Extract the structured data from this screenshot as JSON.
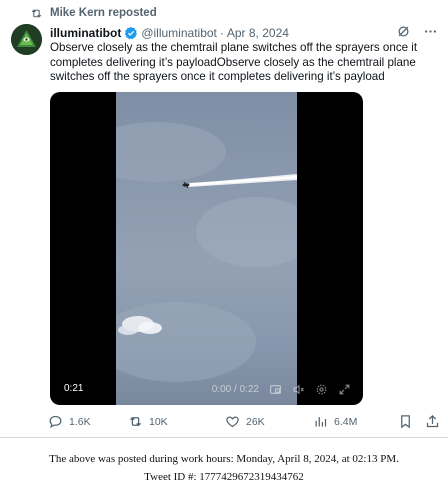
{
  "repost": {
    "label": "Mike Kern reposted"
  },
  "author": {
    "display_name": "illuminatibot",
    "handle": "@illuminatibot",
    "separator": "·",
    "date": "Apr 8, 2024"
  },
  "tweet": {
    "text": "Observe closely as the chemtrail plane switches off the sprayers once it completes delivering it’s payloadObserve closely as the chemtrail plane switches off the sprayers once it completes delivering it’s payload"
  },
  "video": {
    "elapsed": "0:21",
    "position": "0:00 / 0:22"
  },
  "actions": {
    "replies": "1.6K",
    "reposts": "10K",
    "likes": "26K",
    "views": "6.4M"
  },
  "footer": {
    "line1": "The above was posted during work hours: Monday, April 8, 2024, at 02:13 PM.",
    "line2": "Tweet ID #: 1777429672319434762"
  },
  "colors": {
    "verified": "#1d9bf0",
    "muted": "#536471",
    "text": "#0f1419"
  },
  "icons": [
    "repost-icon",
    "verified-badge-icon",
    "grok-icon",
    "more-icon",
    "reply-icon",
    "like-icon",
    "views-icon",
    "bookmark-icon",
    "share-icon",
    "settings-icon",
    "volume-icon",
    "fullscreen-icon",
    "pip-icon"
  ]
}
